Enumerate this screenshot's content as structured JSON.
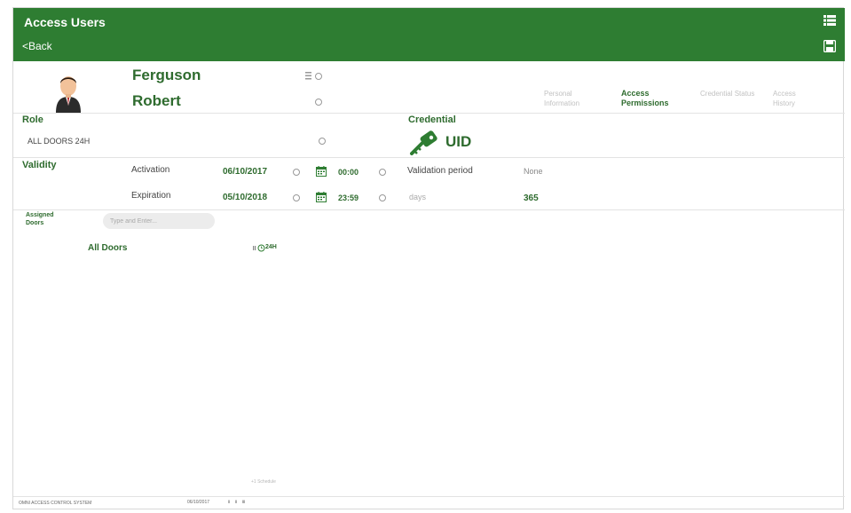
{
  "header": {
    "title": "Access Users",
    "back_label": "<Back",
    "menu_icon": "list-menu-icon",
    "save_icon": "floppy-save-icon",
    "color": "#2e7d32"
  },
  "user": {
    "last_name": "Ferguson",
    "first_name": "Robert",
    "avatar_icon": "person-avatar-icon"
  },
  "tabs": [
    {
      "label": "Personal Information",
      "active": false
    },
    {
      "label": "Access Permissions",
      "active": true
    },
    {
      "label": "Credential Status",
      "active": false
    },
    {
      "label": "Access History",
      "active": false
    }
  ],
  "role": {
    "label": "Role",
    "value": "ALL DOORS 24H"
  },
  "credential": {
    "label": "Credential",
    "value": "UID",
    "icon": "key-icon"
  },
  "validity": {
    "label": "Validity",
    "activation": {
      "label": "Activation",
      "date": "06/10/2017",
      "time": "00:00"
    },
    "expiration": {
      "label": "Expiration",
      "date": "05/10/2018",
      "time": "23:59"
    },
    "validation_period_label": "Validation period",
    "validation_period_value": "None",
    "days_label": "days",
    "days_value": "365"
  },
  "assigned_doors": {
    "label": "Assigned Doors",
    "search_placeholder": "Type and Enter...",
    "items": [
      {
        "name": "All Doors",
        "schedule": "24H"
      }
    ]
  },
  "bottom_mini_text": "+1 Schedule",
  "footer": {
    "left_text": "OMNI ACCESS CONTROL SYSTEM",
    "date_text": "06/10/2017",
    "icons_text": "Ⅱ Ⅱ Ⅲ"
  },
  "colors": {
    "accent": "#2e7d32",
    "accent_text": "#2e6b2e",
    "muted": "#c2c2c2"
  }
}
